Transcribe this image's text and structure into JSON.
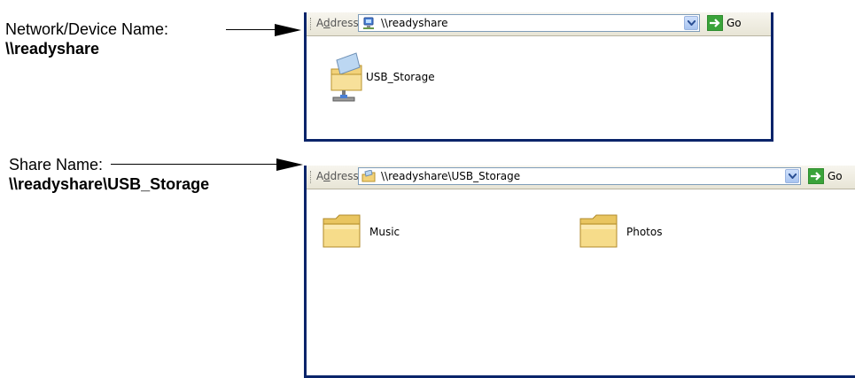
{
  "callouts": {
    "device": {
      "label": "Network/Device Name:",
      "value": "\\\\readyshare"
    },
    "share": {
      "label": "Share Name:",
      "value": "\\\\readyshare\\USB_Storage"
    }
  },
  "window1": {
    "address_label": "Address",
    "address_value": "\\\\readyshare",
    "go_label": "Go",
    "items": [
      {
        "label": "USB_Storage",
        "icon": "network-share-folder-icon"
      }
    ]
  },
  "window2": {
    "address_label": "Address",
    "address_value": "\\\\readyshare\\USB_Storage",
    "go_label": "Go",
    "items": [
      {
        "label": "Music",
        "icon": "folder-icon"
      },
      {
        "label": "Photos",
        "icon": "folder-icon"
      }
    ]
  }
}
